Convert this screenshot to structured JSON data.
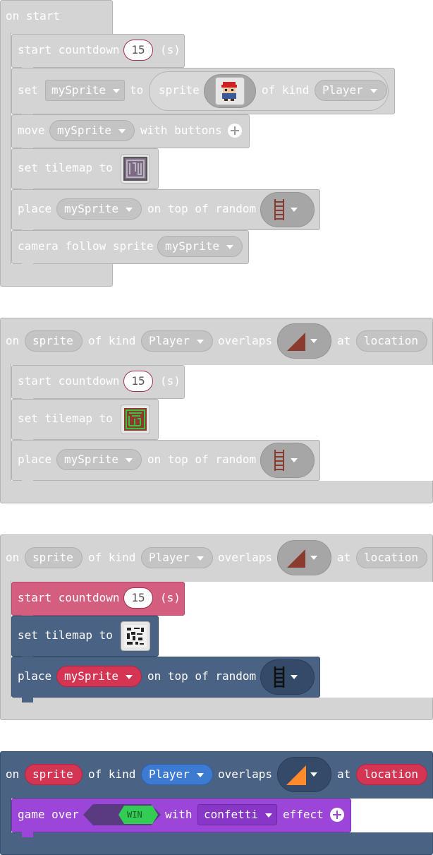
{
  "on_start": {
    "hat": "on start",
    "countdown": {
      "start": "start countdown",
      "value": "15",
      "unit": "(s)"
    },
    "set_sprite": {
      "set": "set",
      "var": "mySprite",
      "to": "to",
      "sprite": "sprite",
      "of_kind": "of kind",
      "kind": "Player"
    },
    "move": {
      "move": "move",
      "var": "mySprite",
      "with_buttons": "with buttons"
    },
    "tilemap": {
      "label": "set tilemap to"
    },
    "place": {
      "place": "place",
      "var": "mySprite",
      "rest": "on top of random"
    },
    "camera": {
      "label": "camera follow sprite",
      "var": "mySprite"
    }
  },
  "overlap_events": [
    {
      "hat": {
        "on": "on",
        "sprite": "sprite",
        "of_kind": "of kind",
        "kind": "Player",
        "overlaps": "overlaps",
        "at": "at",
        "location": "location"
      },
      "countdown": {
        "start": "start countdown",
        "value": "15",
        "unit": "(s)"
      },
      "tilemap": {
        "label": "set tilemap to"
      },
      "place": {
        "place": "place",
        "var": "mySprite",
        "rest": "on top of random"
      }
    },
    {
      "hat": {
        "on": "on",
        "sprite": "sprite",
        "of_kind": "of kind",
        "kind": "Player",
        "overlaps": "overlaps",
        "at": "at",
        "location": "location"
      },
      "countdown": {
        "start": "start countdown",
        "value": "15",
        "unit": "(s)"
      },
      "tilemap": {
        "label": "set tilemap to"
      },
      "place": {
        "place": "place",
        "var": "mySprite",
        "rest": "on top of random"
      }
    },
    {
      "hat": {
        "on": "on",
        "sprite": "sprite",
        "of_kind": "of kind",
        "kind": "Player",
        "overlaps": "overlaps",
        "at": "at",
        "location": "location"
      },
      "game_over": {
        "label": "game over",
        "win": "WIN",
        "with": "with",
        "effect_value": "confetti",
        "effect": "effect"
      }
    }
  ],
  "colors": {
    "gray": "#d4d4d4",
    "pink": "#d45e7d",
    "navy": "#4a6283",
    "purple": "#9b45d9",
    "red": "#d43553",
    "blue": "#3d7bd3",
    "green": "#33cc55"
  },
  "icons": [
    "plus-icon",
    "dropdown-arrow-icon",
    "ladder-tile-icon",
    "ramp-tile-icon",
    "tilemap-thumbnail",
    "sprite-image-thumbnail"
  ]
}
